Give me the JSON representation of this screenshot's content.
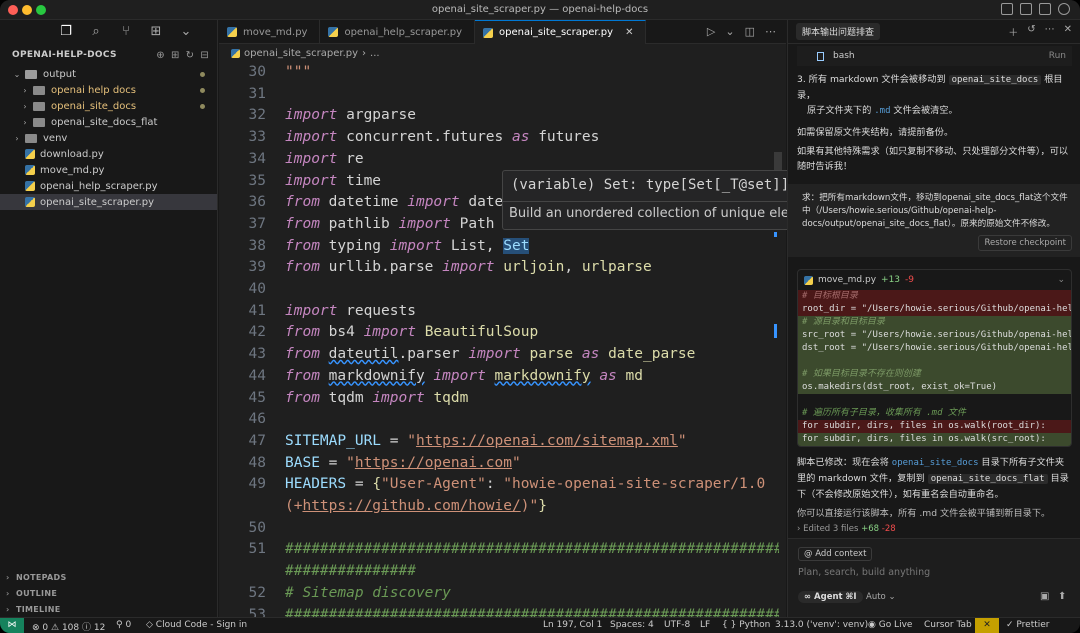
{
  "window": {
    "title": "openai_site_scraper.py — openai-help-docs"
  },
  "sidebar": {
    "header": "OPENAI-HELP-DOCS",
    "tree": [
      {
        "label": "output",
        "kind": "folder",
        "open": true,
        "depth": 0,
        "dot": true
      },
      {
        "label": "openai help docs",
        "kind": "folder",
        "open": false,
        "depth": 1,
        "dot": true,
        "yellow": true
      },
      {
        "label": "openai_site_docs",
        "kind": "folder",
        "open": false,
        "depth": 1,
        "dot": true,
        "yellow": true
      },
      {
        "label": "openai_site_docs_flat",
        "kind": "folder",
        "open": false,
        "depth": 1
      },
      {
        "label": "venv",
        "kind": "folder",
        "open": false,
        "depth": 0
      },
      {
        "label": "download.py",
        "kind": "py",
        "depth": 0
      },
      {
        "label": "move_md.py",
        "kind": "py",
        "depth": 0
      },
      {
        "label": "openai_help_scraper.py",
        "kind": "py",
        "depth": 0
      },
      {
        "label": "openai_site_scraper.py",
        "kind": "py",
        "depth": 0,
        "selected": true
      }
    ],
    "sections": [
      "NOTEPADS",
      "OUTLINE",
      "TIMELINE"
    ]
  },
  "editor": {
    "tabs": [
      {
        "label": "move_md.py",
        "active": false
      },
      {
        "label": "openai_help_scraper.py",
        "active": false
      },
      {
        "label": "openai_site_scraper.py",
        "active": true
      }
    ],
    "breadcrumb": [
      "openai_site_scraper.py",
      "..."
    ],
    "hover": {
      "signature": "(variable) Set: type[Set[_T@set]]",
      "doc": "Build an unordered collection of unique elements."
    },
    "lines": [
      {
        "n": "30",
        "html": "<span class=\"str\">\"\"\"</span>"
      },
      {
        "n": "31",
        "html": ""
      },
      {
        "n": "32",
        "html": "<span class=\"kw\">import</span> argparse"
      },
      {
        "n": "33",
        "html": "<span class=\"kw\">import</span> concurrent.futures <span class=\"kw\">as</span> futures"
      },
      {
        "n": "34",
        "html": "<span class=\"kw\">import</span> re"
      },
      {
        "n": "35",
        "html": "<span class=\"kw\">import</span> time"
      },
      {
        "n": "36",
        "html": "<span class=\"kw\">from</span> datetime <span class=\"kw\">import</span> date"
      },
      {
        "n": "37",
        "html": "<span class=\"kw\">from</span> pathlib <span class=\"kw\">import</span> Path"
      },
      {
        "n": "38",
        "html": "<span class=\"kw\">from</span> typing <span class=\"kw\">import</span> List, <span class=\"var hl\">Set</span>"
      },
      {
        "n": "39",
        "html": "<span class=\"kw\">from</span> urllib.parse <span class=\"kw\">import</span> <span class=\"fn\">urljoin</span>, <span class=\"fn\">urlparse</span>"
      },
      {
        "n": "40",
        "html": ""
      },
      {
        "n": "41",
        "html": "<span class=\"kw\">import</span> requests"
      },
      {
        "n": "42",
        "html": "<span class=\"kw\">from</span> bs4 <span class=\"kw\">import</span> <span class=\"fn\">BeautifulSoup</span>"
      },
      {
        "n": "43",
        "html": "<span class=\"kw\">from</span> <span class=\"squig\">dateutil</span>.parser <span class=\"kw\">import</span> <span class=\"fn\">parse</span> <span class=\"kw\">as</span> <span class=\"fn\">date_parse</span>"
      },
      {
        "n": "44",
        "html": "<span class=\"kw\">from</span> <span class=\"squig\">markdownify</span> <span class=\"kw\">import</span> <span class=\"fn squig\">markdownify</span> <span class=\"kw\">as</span> <span class=\"fn\">md</span>"
      },
      {
        "n": "45",
        "html": "<span class=\"kw\">from</span> tqdm <span class=\"kw\">import</span> <span class=\"fn\">tqdm</span>"
      },
      {
        "n": "46",
        "html": ""
      },
      {
        "n": "47",
        "html": "<span class=\"var\">SITEMAP_URL</span> = <span class=\"str\">\"<span class=\"url\">https://openai.com/sitemap.xml</span>\"</span>"
      },
      {
        "n": "48",
        "html": "<span class=\"var\">BASE</span> = <span class=\"str\">\"<span class=\"url\">https://openai.com</span>\"</span>"
      },
      {
        "n": "49",
        "html": "<span class=\"var\">HEADERS</span> = <span class=\"fn\">{</span><span class=\"str\">\"User-Agent\"</span>: <span class=\"str\">\"howie-openai-site-scraper/1.0</span>"
      },
      {
        "n": "",
        "html": "<span class=\"str\">(+<span class=\"url\">https://github.com/howie/</span>)\"</span><span class=\"fn\">}</span>"
      },
      {
        "n": "50",
        "html": ""
      },
      {
        "n": "51",
        "html": "<span class=\"cmt\">##############################################################</span>"
      },
      {
        "n": "",
        "html": "<span class=\"cmt\">###############</span>"
      },
      {
        "n": "52",
        "html": "<span class=\"cmt\"># Sitemap discovery</span>"
      },
      {
        "n": "53",
        "html": "<span class=\"cmt\">##############################################################</span>"
      }
    ]
  },
  "chat": {
    "tab": "脚本输出问题排查",
    "bash_label": "bash",
    "run_label": "Run",
    "item3_prefix": "3. 所有 markdown 文件会被移动到 ",
    "item3_code": "openai_site_docs",
    "item3_suffix": " 根目录，",
    "item3_line2_prefix": "原子文件夹下的 ",
    "item3_line2_code": ".md",
    "item3_line2_suffix": " 文件会被清空。",
    "para1": "如需保留原文件夹结构，请提前备份。",
    "para2": "如果有其他特殊需求（如只复制不移动、只处理部分文件等），可以随时告诉我！",
    "user_msg": "求：把所有markdown文件，移动到openai_site_docs_flat这个文件中（/Users/howie.serious/Github/openai-help-docs/output/openai_site_docs_flat）。原来的原始文件不修改。",
    "restore_label": "Restore checkpoint",
    "diff_file": "move_md.py",
    "diff_add": "+13",
    "diff_del": "-9",
    "diff_lines": [
      {
        "t": "# 目标根目录",
        "c": "cm del"
      },
      {
        "t": "root_dir = \"/Users/howie.serious/Github/openai-hel",
        "c": "del"
      },
      {
        "t": "# 源目录和目标目录",
        "c": "cm add"
      },
      {
        "t": "src_root = \"/Users/howie.serious/Github/openai-hel",
        "c": "add"
      },
      {
        "t": "dst_root = \"/Users/howie.serious/Github/openai-hel",
        "c": "add"
      },
      {
        "t": "",
        "c": "add"
      },
      {
        "t": "# 如果目标目录不存在则创建",
        "c": "cm add"
      },
      {
        "t": "os.makedirs(dst_root, exist_ok=True)",
        "c": "add"
      },
      {
        "t": "",
        "c": ""
      },
      {
        "t": "# 遍历所有子目录，收集所有 .md 文件",
        "c": "cm"
      },
      {
        "t": "for subdir, dirs, files in os.walk(root_dir):",
        "c": "del"
      },
      {
        "t": "for subdir, dirs, files in os.walk(src_root):",
        "c": "add"
      }
    ],
    "summary_prefix": "脚本已修改：现在会将 ",
    "summary_code1": "openai_site_docs",
    "summary_mid": " 目录下所有子文件夹里的 markdown 文件，复制到 ",
    "summary_code2": "openai_site_docs_flat",
    "summary_suffix": " 目录下（不会修改原始文件），如有重名会自动重命名。",
    "summary_cut": "你可以直接运行该脚本，所有 .md 文件会被平铺到新目录下。",
    "edited_label": "Edited 3 files",
    "edited_add": "+68",
    "edited_del": "-28",
    "add_context": "Add context",
    "placeholder": "Plan, search, build anything",
    "agent_label": "Agent ⌘I",
    "auto_label": "Auto"
  },
  "status": {
    "errors": "0",
    "warnings": "108",
    "info": "12",
    "ports": "0",
    "cloud": "Cloud Code - Sign in",
    "position": "Ln 197, Col 1",
    "spaces": "Spaces: 4",
    "encoding": "UTF-8",
    "eol": "LF",
    "language": "Python",
    "interpreter": "3.13.0 ('venv': venv)",
    "golive": "Go Live",
    "cursor_tab": "Cursor Tab",
    "prettier": "Prettier"
  },
  "colors": {
    "accent": "#0078d4",
    "remote": "#16825d",
    "bell": "#c5a000"
  }
}
